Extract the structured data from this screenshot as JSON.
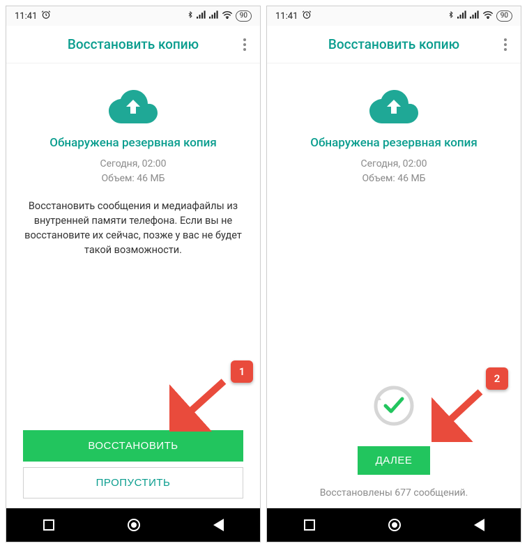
{
  "status": {
    "time": "11:41",
    "battery": "90"
  },
  "app_bar": {
    "title": "Восстановить копию"
  },
  "screen1": {
    "found_title": "Обнаружена резервная копия",
    "meta_time": "Сегодня, 02:00",
    "meta_size": "Объем: 46 МБ",
    "description": "Восстановить сообщения и медиафайлы из внутренней памяти телефона. Если вы не восстановите их сейчас, позже у вас не будет такой возможности.",
    "restore_btn": "ВОССТАНОВИТЬ",
    "skip_btn": "ПРОПУСТИТЬ",
    "callout": "1"
  },
  "screen2": {
    "found_title": "Обнаружена резервная копия",
    "meta_time": "Сегодня, 02:00",
    "meta_size": "Объем: 46 МБ",
    "next_btn": "ДАЛЕЕ",
    "restored_text": "Восстановлены 677 сообщений.",
    "callout": "2"
  }
}
